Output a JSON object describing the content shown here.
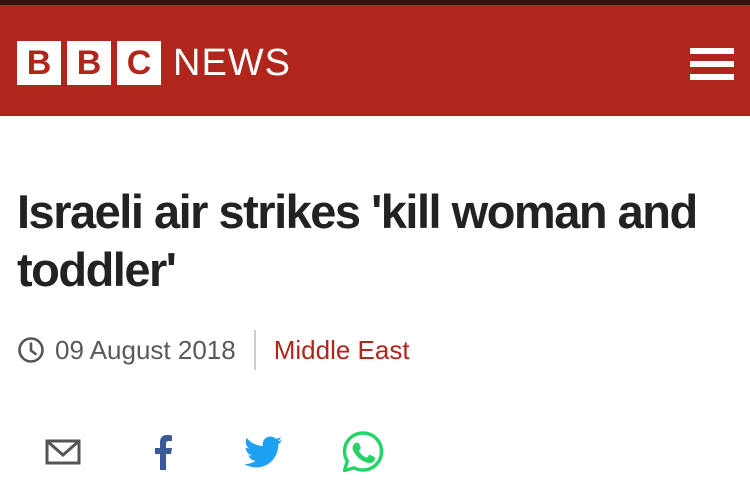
{
  "header": {
    "logo_letters": [
      "B",
      "B",
      "C"
    ],
    "logo_word": "NEWS",
    "menu_icon": "hamburger-menu-icon",
    "background_color": "#b0261c"
  },
  "article": {
    "headline": "Israeli air strikes 'kill woman and toddler'",
    "date": "09 August 2018",
    "section": "Middle East",
    "section_color": "#b0261c"
  },
  "share": {
    "icons": [
      "email-icon",
      "facebook-icon",
      "twitter-icon",
      "whatsapp-icon"
    ],
    "colors": {
      "email": "#555555",
      "facebook": "#3b5998",
      "twitter": "#1da1f2",
      "whatsapp": "#25d366"
    }
  }
}
